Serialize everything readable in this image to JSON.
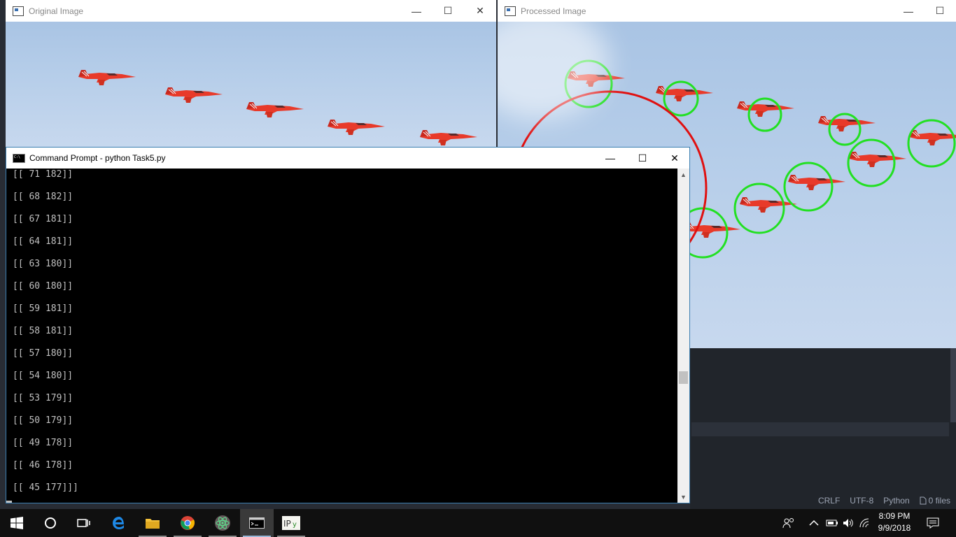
{
  "windows": {
    "original": {
      "title": "Original Image"
    },
    "processed": {
      "title": "Processed Image"
    },
    "cmd": {
      "title": "Command Prompt - python  Task5.py",
      "lines": [
        "[[ 71 182]]",
        "[[ 68 182]]",
        "[[ 67 181]]",
        "[[ 64 181]]",
        "[[ 63 180]]",
        "[[ 60 180]]",
        "[[ 59 181]]",
        "[[ 58 181]]",
        "[[ 57 180]]",
        "[[ 54 180]]",
        "[[ 53 179]]",
        "[[ 50 179]]",
        "[[ 49 178]]",
        "[[ 46 178]]",
        "[[ 45 177]]]"
      ]
    }
  },
  "statusbar": {
    "line_ending": "CRLF",
    "encoding": "UTF-8",
    "language": "Python",
    "files": "0 files"
  },
  "taskbar": {
    "time": "8:09 PM",
    "date": "9/9/2018",
    "apps": [
      "windows-start-icon",
      "search-icon",
      "task-view-icon",
      "edge-icon",
      "file-explorer-icon",
      "chrome-icon",
      "atom-icon",
      "command-prompt-icon",
      "ipython-icon"
    ]
  },
  "colors": {
    "detection_circle": "#22e022",
    "large_circle": "#e01010",
    "jet": "#e83a2a",
    "console_bg": "#000000",
    "console_text": "#c0c0c0"
  }
}
